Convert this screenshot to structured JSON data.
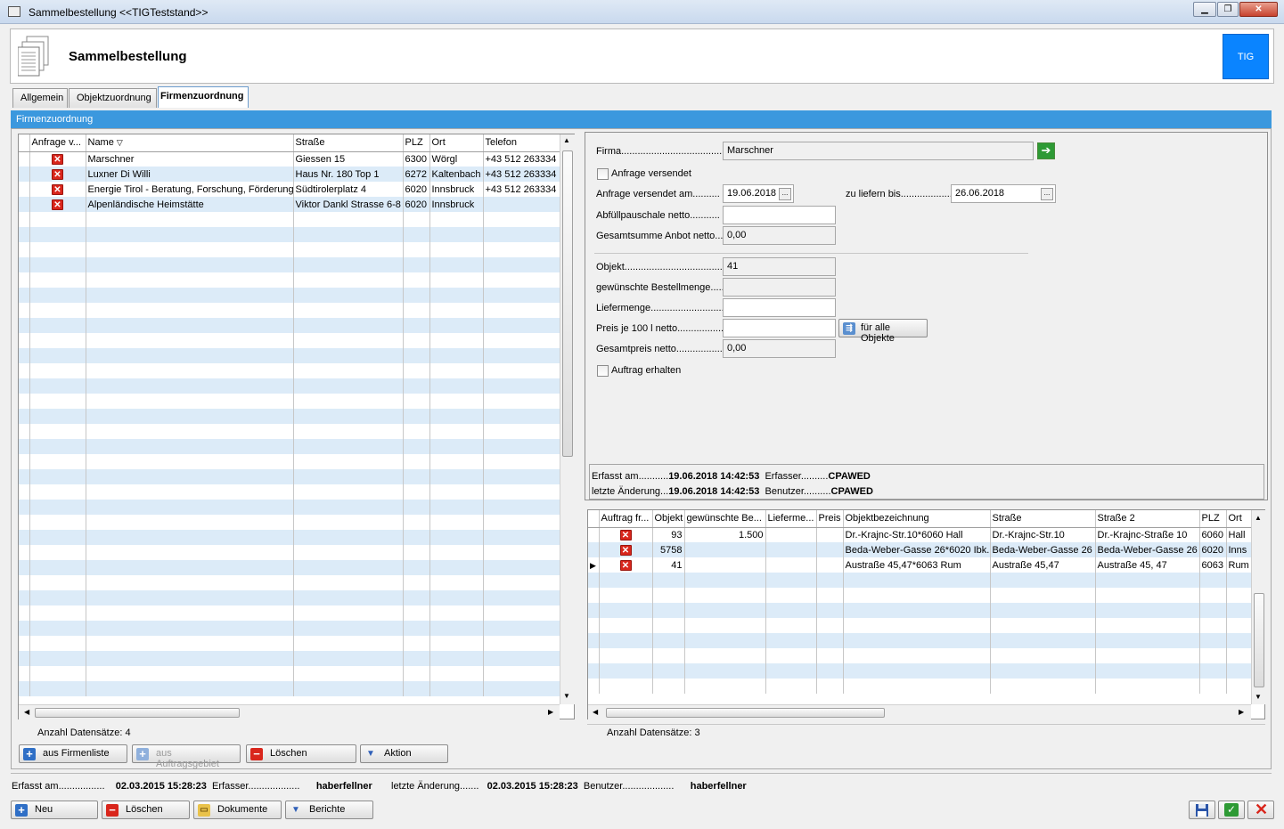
{
  "window": {
    "title": "Sammelbestellung  <<TIGTeststand>>"
  },
  "header": {
    "title": "Sammelbestellung",
    "badge": "TIG"
  },
  "tabs": [
    "Allgemein",
    "Objektzuordnung",
    "Firmenzuordnung"
  ],
  "section": {
    "title": "Firmenzuordnung"
  },
  "left_table": {
    "columns": [
      "Anfrage v...",
      "Name",
      "Straße",
      "PLZ",
      "Ort",
      "Telefon"
    ],
    "rows": [
      {
        "name": "Marschner",
        "strasse": "Giessen 15",
        "plz": "6300",
        "ort": "Wörgl",
        "telefon": "+43 512 263334"
      },
      {
        "name": "Luxner Di Willi",
        "strasse": "Haus Nr. 180 Top 1",
        "plz": "6272",
        "ort": "Kaltenbach",
        "telefon": "+43 512 263334"
      },
      {
        "name": "Energie Tirol - Beratung, Forschung, Förderung",
        "strasse": "Südtirolerplatz 4",
        "plz": "6020",
        "ort": "Innsbruck",
        "telefon": "+43 512 263334"
      },
      {
        "name": "Alpenländische Heimstätte",
        "strasse": "Viktor Dankl Strasse 6-8",
        "plz": "6020",
        "ort": "Innsbruck",
        "telefon": ""
      }
    ],
    "count_label": "Anzahl Datensätze: 4"
  },
  "left_buttons": {
    "add_list": "aus Firmenliste",
    "add_area": "aus Auftragsgebiet",
    "delete": "Löschen",
    "action": "Aktion"
  },
  "form": {
    "firma_label": "Firma.......................................",
    "firma_value": "Marschner",
    "anfrage_versendet": "Anfrage versendet",
    "versendet_am_label": "Anfrage versendet am..........",
    "versendet_am_value": "19.06.2018",
    "liefern_bis_label": "zu liefern bis.....................",
    "liefern_bis_value": "26.06.2018",
    "abfuell_label": "Abfüllpauschale netto...........",
    "abfuell_value": "",
    "gesamtsumme_label": "Gesamtsumme Anbot netto.....",
    "gesamtsumme_value": "0,00",
    "objekt_label": "Objekt.........................................",
    "objekt_value": "41",
    "bestellmenge_label": "gewünschte Bestellmenge.......",
    "bestellmenge_value": "",
    "liefermenge_label": "Liefermenge.................................",
    "liefermenge_value": "",
    "preis_label": "Preis je 100 l netto...................",
    "preis_value": "",
    "fuer_alle": "für alle Objekte",
    "gesamtpreis_label": "Gesamtpreis netto......................",
    "gesamtpreis_value": "0,00",
    "auftrag_erhalten": "Auftrag erhalten"
  },
  "audit_right": {
    "erfasst_am_label": "Erfasst am...........",
    "erfasst_am_value": "19.06.2018 14:42:53",
    "erfasser_label": "Erfasser..........",
    "erfasser_value": "CPAWED",
    "aenderung_label": "letzte Änderung...",
    "aenderung_value": "19.06.2018 14:42:53",
    "benutzer_label": "Benutzer..........",
    "benutzer_value": "CPAWED"
  },
  "right_table": {
    "columns": [
      "Auftrag fr...",
      "Objekt",
      "gewünschte Be...",
      "Lieferme...",
      "Preis",
      "Objektbezeichnung",
      "Straße",
      "Straße 2",
      "PLZ",
      "Ort"
    ],
    "rows": [
      {
        "objekt": "93",
        "menge": "1.500",
        "bez": "Dr.-Krajnc-Str.10*6060 Hall",
        "strasse": "Dr.-Krajnc-Str.10",
        "strasse2": "Dr.-Krajnc-Straße 10",
        "plz": "6060",
        "ort": "Hall"
      },
      {
        "objekt": "5758",
        "menge": "",
        "bez": "Beda-Weber-Gasse 26*6020 Ibk.",
        "strasse": "Beda-Weber-Gasse 26",
        "strasse2": "Beda-Weber-Gasse 26",
        "plz": "6020",
        "ort": "Inns"
      },
      {
        "objekt": "41",
        "menge": "",
        "bez": "Austraße 45,47*6063 Rum",
        "strasse": "Austraße 45,47",
        "strasse2": "Austraße 45, 47",
        "plz": "6063",
        "ort": "Rum"
      }
    ],
    "count_label": "Anzahl Datensätze: 3"
  },
  "footer": {
    "erfasst_am_label": "Erfasst am.................",
    "erfasst_am_value": "02.03.2015 15:28:23",
    "erfasser_label": "Erfasser...................",
    "erfasser_value": "haberfellner",
    "aenderung_label": "letzte Änderung.......",
    "aenderung_value": "02.03.2015 15:28:23",
    "benutzer_label": "Benutzer...................",
    "benutzer_value": "haberfellner"
  },
  "bottom_buttons": {
    "new": "Neu",
    "delete": "Löschen",
    "documents": "Dokumente",
    "reports": "Berichte"
  },
  "colors": {
    "section": "#3b98de",
    "badge": "#0a84ff",
    "row_alt": "#dcebf8",
    "delete_red": "#d9261c"
  }
}
